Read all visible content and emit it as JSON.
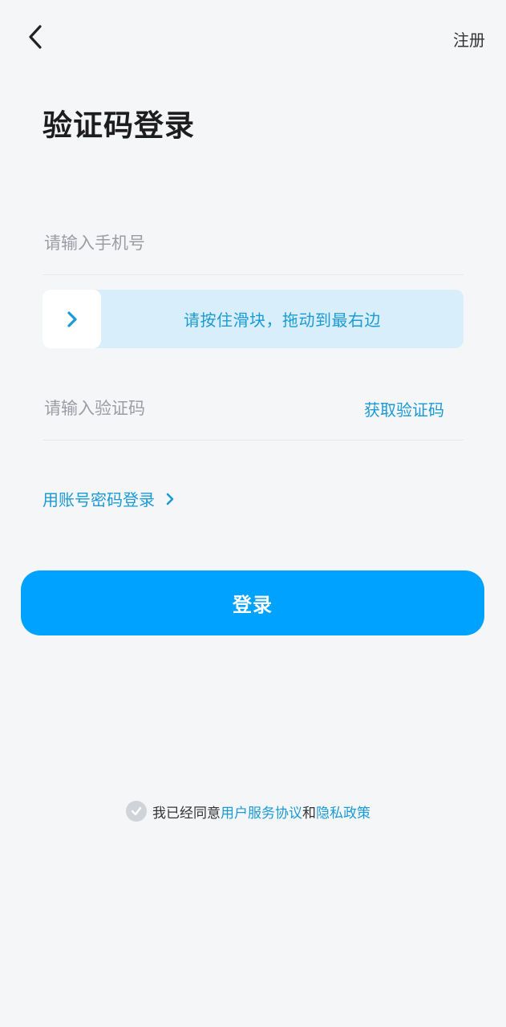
{
  "header": {
    "back_icon": "chevron-left-icon",
    "register_label": "注册"
  },
  "title": "验证码登录",
  "phone": {
    "placeholder": "请输入手机号",
    "value": ""
  },
  "slider": {
    "handle_icon": "chevron-right-icon",
    "text": "请按住滑块，拖动到最右边"
  },
  "code": {
    "placeholder": "请输入验证码",
    "value": "",
    "get_code_label": "获取验证码"
  },
  "password_login": {
    "label": "用账号密码登录",
    "icon": "chevron-right-icon"
  },
  "login_button": {
    "label": "登录"
  },
  "agreement": {
    "checked": false,
    "prefix": "我已经同意",
    "terms_link": "用户服务协议",
    "conjunction": "和",
    "privacy_link": "隐私政策"
  },
  "colors": {
    "accent": "#00a2ff",
    "link": "#1a9ad6",
    "slider_bg": "#d9eefb",
    "background": "#f5f6f8"
  }
}
